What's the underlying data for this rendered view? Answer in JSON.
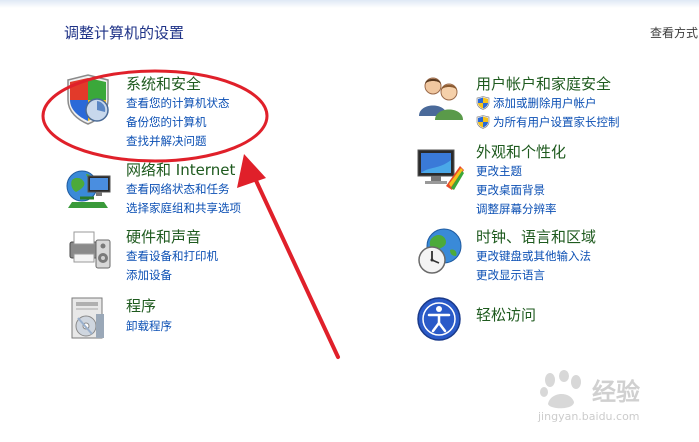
{
  "header": {
    "title": "调整计算机的设置",
    "view_by": "查看方式"
  },
  "categories": {
    "system": {
      "title": "系统和安全",
      "links": [
        "查看您的计算机状态",
        "备份您的计算机",
        "查找并解决问题"
      ],
      "icon": "shield-icon"
    },
    "network": {
      "title": "网络和 Internet",
      "links": [
        "查看网络状态和任务",
        "选择家庭组和共享选项"
      ],
      "icon": "network-globe-icon"
    },
    "hardware": {
      "title": "硬件和声音",
      "links": [
        "查看设备和打印机",
        "添加设备"
      ],
      "icon": "printer-icon"
    },
    "programs": {
      "title": "程序",
      "links": [
        "卸载程序"
      ],
      "icon": "programs-icon"
    },
    "users": {
      "title": "用户帐户和家庭安全",
      "links": [
        "添加或删除用户帐户",
        "为所有用户设置家长控制"
      ],
      "icon": "users-icon"
    },
    "appearance": {
      "title": "外观和个性化",
      "links": [
        "更改主题",
        "更改桌面背景",
        "调整屏幕分辨率"
      ],
      "icon": "monitor-palette-icon"
    },
    "clock": {
      "title": "时钟、语言和区域",
      "links": [
        "更改键盘或其他输入法",
        "更改显示语言"
      ],
      "icon": "clock-globe-icon"
    },
    "ease": {
      "title": "轻松访问",
      "links": [],
      "icon": "ease-of-access-icon"
    }
  },
  "watermark": {
    "brand": "经验",
    "url": "jingyan.baidu.com"
  },
  "colors": {
    "title": "#1e3287",
    "category": "#1e5a1e",
    "link": "#0c50b4",
    "annotation": "#e0202a"
  }
}
